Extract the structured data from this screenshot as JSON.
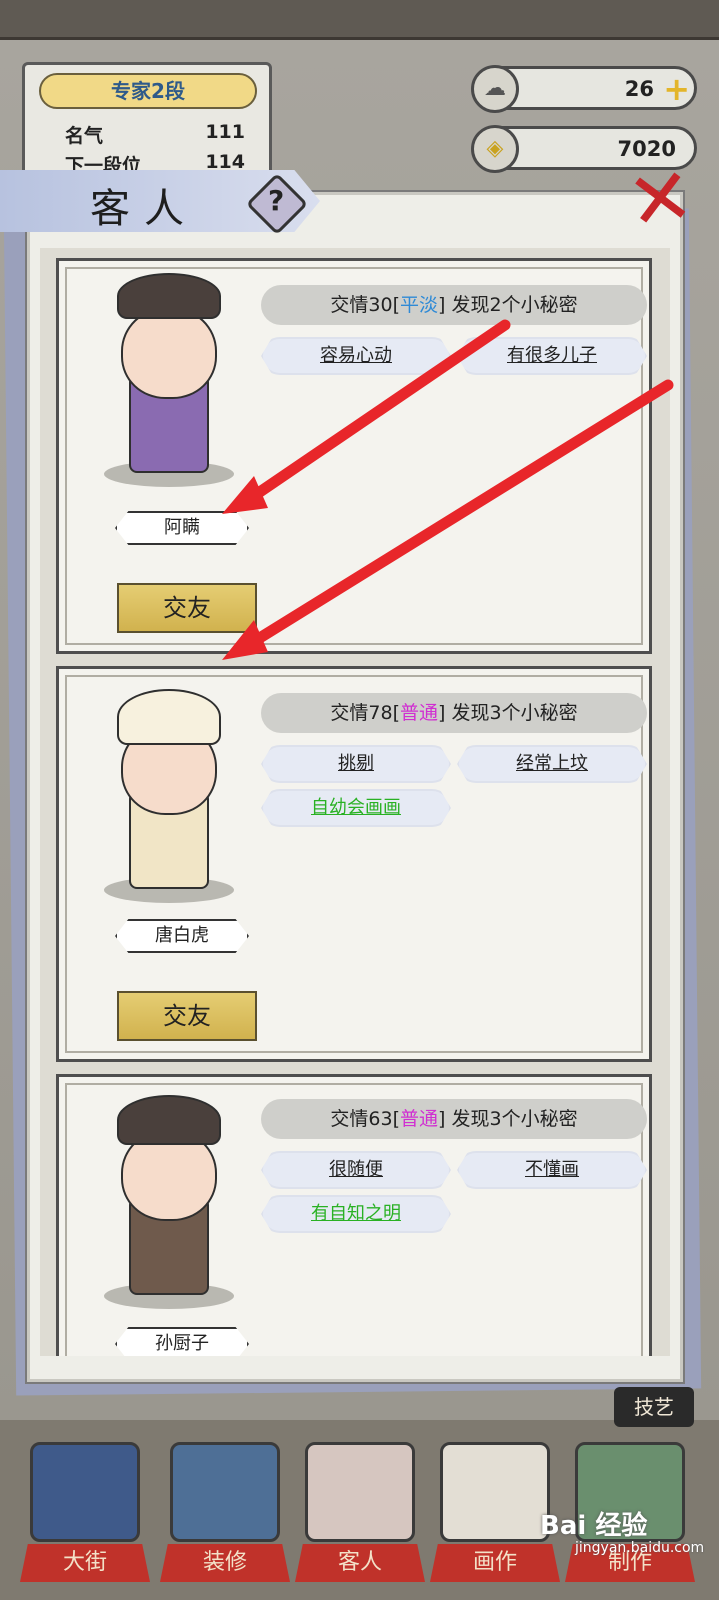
{
  "rank": {
    "title": "专家2段",
    "fame_label": "名气",
    "fame_value": "111",
    "next_label": "下一段位",
    "next_value": "114"
  },
  "currency": {
    "gems": "26",
    "coins": "7020"
  },
  "dialog": {
    "title": "客人",
    "help": "?"
  },
  "guests": [
    {
      "name": "阿瞒",
      "relation_prefix": "交情30[",
      "relation_level": "平淡",
      "relation_suffix": "] 发现2个小秘密",
      "tags": [
        "容易心动",
        "有很多儿子"
      ],
      "action": "交友",
      "level_color": "#2f8ad6"
    },
    {
      "name": "唐白虎",
      "relation_prefix": "交情78[",
      "relation_level": "普通",
      "relation_suffix": "] 发现3个小秘密",
      "tags": [
        "挑剔",
        "经常上坟",
        "自幼会画画"
      ],
      "action": "交友",
      "level_color": "#d02fd1"
    },
    {
      "name": "孙厨子",
      "relation_prefix": "交情63[",
      "relation_level": "普通",
      "relation_suffix": "] 发现3个小秘密",
      "tags": [
        "很随便",
        "不懂画",
        "有自知之明"
      ],
      "level_color": "#d02fd1"
    }
  ],
  "side_button": "技艺",
  "nav": [
    "大街",
    "装修",
    "客人",
    "画作",
    "制作"
  ],
  "watermark": "Bai 经验",
  "watermark_sub": "jingyan.baidu.com",
  "colors": {
    "arrow": "#e8262a",
    "friend_button": "#d9bd5d",
    "nav_label": "#c0322a"
  }
}
